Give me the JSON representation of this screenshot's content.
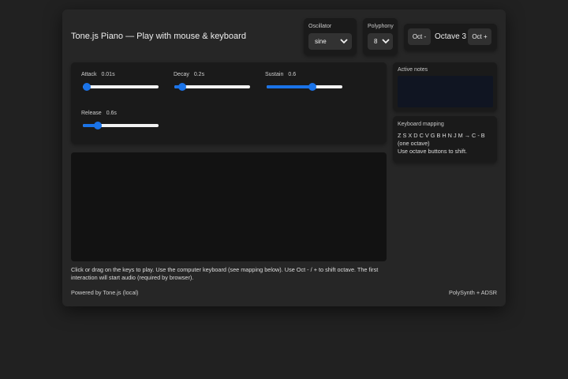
{
  "title": "Tone.js Piano — Play with mouse & keyboard",
  "oscillator": {
    "label": "Oscillator",
    "value": "sine"
  },
  "polyphony": {
    "label": "Polyphony",
    "value": "8"
  },
  "octave": {
    "down_label": "Oct -",
    "display": "Octave 3",
    "up_label": "Oct +"
  },
  "envelope": {
    "attack": {
      "label": "Attack",
      "value": "0.01s",
      "level": 0.0
    },
    "decay": {
      "label": "Decay",
      "value": "0.2s",
      "level": 0.1
    },
    "sustain": {
      "label": "Sustain",
      "value": "0.6",
      "level": 0.6
    },
    "release": {
      "label": "Release",
      "value": "0.6s",
      "level": 0.2
    }
  },
  "accent_color": "#1a73e8",
  "help_text": "Click or drag on the keys to play. Use the computer keyboard (see mapping below). Use Oct - / + to shift octave. The first interaction will start audio (required by browser).",
  "footer": {
    "left": "Powered by Tone.js (local)",
    "right": "PolySynth + ADSR"
  },
  "active_notes": {
    "label": "Active notes"
  },
  "keyboard_mapping": {
    "label": "Keyboard mapping",
    "line1": "Z S X D C V G B H N J M  →  C - B (one octave)",
    "line2": "Use octave buttons to shift."
  }
}
